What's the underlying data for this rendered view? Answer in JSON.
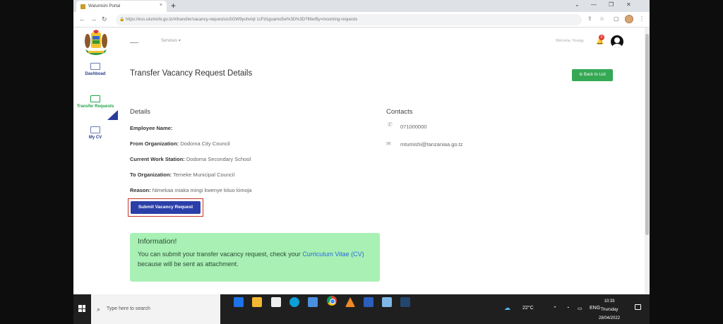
{
  "browser": {
    "tab_title": "Watumishi Portal",
    "tab_close": "×",
    "new_tab": "+",
    "url": "https://ess.utumishi.go.tz/#/transfer/vacancy-requests/uSGW9yuhvIqI 1cFd1guamo5w%3D%3D?filterBy=incoming-requests",
    "window_controls": [
      "⌄",
      "—",
      "❐",
      "✕"
    ]
  },
  "sidebar": {
    "items": [
      {
        "label": "Dashboad"
      },
      {
        "label": "Transfer Requests"
      },
      {
        "label": "My CV"
      }
    ]
  },
  "appbar": {
    "services": "Services",
    "welcome": "Welcome, Youngy",
    "notification_count": "0"
  },
  "page": {
    "title": "Transfer Vacancy Request Details",
    "back_button": "Back to List"
  },
  "details": {
    "heading": "Details",
    "employee_name_label": "Employee Name:",
    "employee_name_value": "",
    "from_org_label": "From Organization:",
    "from_org_value": "Dodoma City Council",
    "station_label": "Current Work Station:",
    "station_value": "Dodoma Secondary School",
    "to_org_label": "To Organization:",
    "to_org_value": "Temeke Municipal Council",
    "reason_label": "Reason:",
    "reason_value": "Nimekaa miaka mingi kwenye kituo kimoja"
  },
  "contacts": {
    "heading": "Contacts",
    "phone": "071000000",
    "email": "mtumishi@tanzaniaa.go.tz"
  },
  "submit_button": "Submit Vacancy Request",
  "info": {
    "title": "Information!",
    "text_before": "You can submit your transfer vacancy request, check your",
    "link": "Curriculum Vitae (CV)",
    "text_after": "because will be sent as attachment."
  },
  "taskbar": {
    "search_placeholder": "Type here to search",
    "temperature": "22°C",
    "language": "ENG",
    "time": "10:33",
    "day": "Thursday",
    "date": "28/04/2022"
  }
}
